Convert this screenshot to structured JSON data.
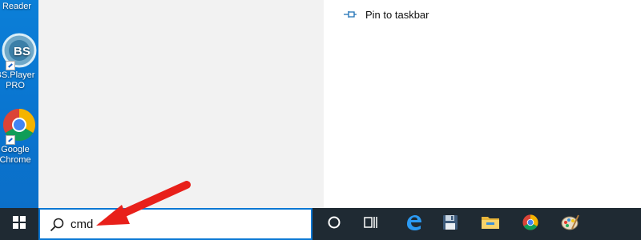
{
  "desktop": {
    "icons": [
      {
        "label": "Reader",
        "icon": "pdf-reader-icon"
      },
      {
        "label": "BS.Player PRO",
        "icon": "bsplayer-icon"
      },
      {
        "label": "Google Chrome",
        "icon": "chrome-icon"
      }
    ]
  },
  "start_menu": {
    "context_items": [
      {
        "label": "Pin to taskbar",
        "icon": "pin-icon"
      }
    ]
  },
  "taskbar": {
    "start_icon": "windows-logo-icon",
    "search": {
      "value": "cmd",
      "icon": "search-icon"
    },
    "icons": [
      {
        "name": "cortana-icon"
      },
      {
        "name": "task-view-icon"
      },
      {
        "name": "edge-icon"
      },
      {
        "name": "floppy-save-icon"
      },
      {
        "name": "file-explorer-icon"
      },
      {
        "name": "chrome-icon"
      },
      {
        "name": "paint-icon"
      }
    ]
  },
  "annotation": {
    "color": "#e8201a"
  },
  "colors": {
    "accent": "#0a78d4",
    "taskbar": "#1f2a33"
  }
}
